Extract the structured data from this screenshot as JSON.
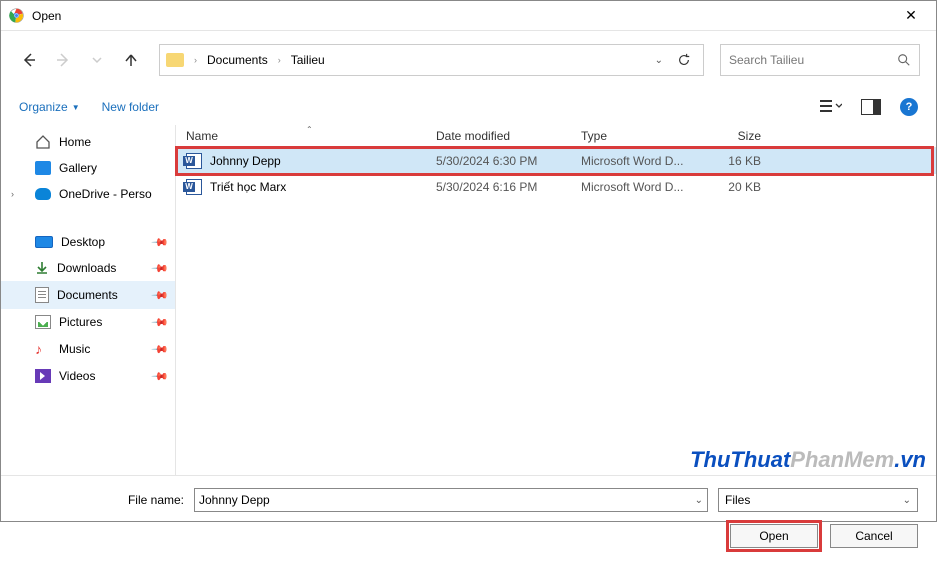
{
  "window": {
    "title": "Open"
  },
  "breadcrumb": {
    "seg1": "Documents",
    "seg2": "Tailieu"
  },
  "search": {
    "placeholder": "Search Tailieu"
  },
  "toolbar": {
    "organize": "Organize",
    "newfolder": "New folder"
  },
  "sidebar": {
    "home": "Home",
    "gallery": "Gallery",
    "onedrive": "OneDrive - Perso",
    "desktop": "Desktop",
    "downloads": "Downloads",
    "documents": "Documents",
    "pictures": "Pictures",
    "music": "Music",
    "videos": "Videos"
  },
  "columns": {
    "name": "Name",
    "date": "Date modified",
    "type": "Type",
    "size": "Size"
  },
  "files": {
    "f0": {
      "name": "Johnny Depp",
      "date": "5/30/2024 6:30 PM",
      "type": "Microsoft Word D...",
      "size": "16 KB"
    },
    "f1": {
      "name": "Triết học Marx",
      "date": "5/30/2024 6:16 PM",
      "type": "Microsoft Word D...",
      "size": "20 KB"
    }
  },
  "footer": {
    "filename_label": "File name:",
    "filename_value": "Johnny Depp",
    "filter": "Files",
    "open": "Open",
    "cancel": "Cancel"
  },
  "watermark": {
    "a": "ThuThuat",
    "b": "PhanMem",
    "c": ".vn"
  }
}
